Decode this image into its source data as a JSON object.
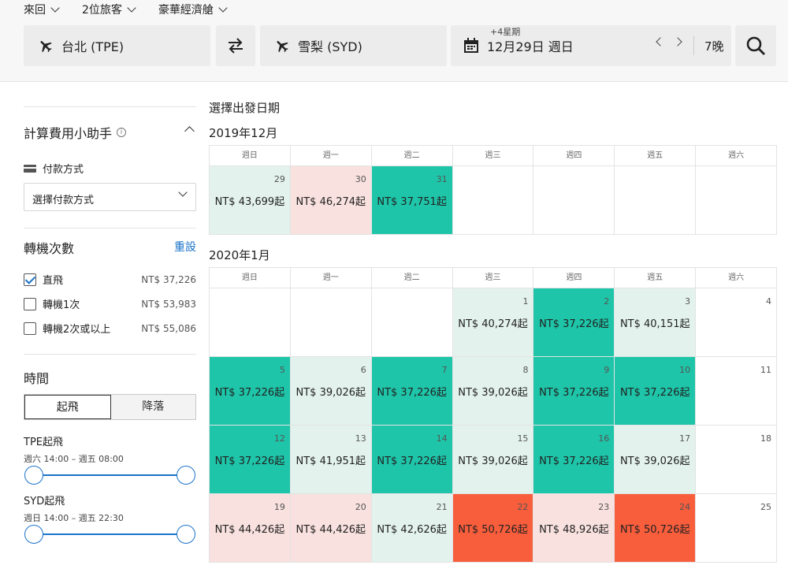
{
  "header": {
    "trip_type": "來回",
    "travelers": "2位旅客",
    "cabin": "豪華經濟艙",
    "from": "台北 (TPE)",
    "to": "雪梨 (SYD)",
    "date_sub": "+4星期",
    "date": "12月29日 週日",
    "nights": "7晚"
  },
  "sidebar": {
    "calc_title": "計算費用小助手",
    "pay_label": "付款方式",
    "pay_select": "選擇付款方式",
    "stops_title": "轉機次數",
    "reset": "重設",
    "stops": [
      {
        "label": "直飛",
        "price": "NT$ 37,226",
        "checked": true
      },
      {
        "label": "轉機1次",
        "price": "NT$ 53,983",
        "checked": false
      },
      {
        "label": "轉機2次或以上",
        "price": "NT$ 55,086",
        "checked": false
      }
    ],
    "time_title": "時間",
    "tab_depart": "起飛",
    "tab_land": "降落",
    "tpe_label": "TPE起飛",
    "tpe_range": "週六 14:00 – 週五 08:00",
    "syd_label": "SYD起飛",
    "syd_range": "週日 14:00 – 週五 22:30"
  },
  "calendar": {
    "heading": "選擇出發日期",
    "weekdays": [
      "週日",
      "週一",
      "週二",
      "週三",
      "週四",
      "週五",
      "週六"
    ],
    "months": [
      {
        "title": "2019年12月",
        "weeks": [
          [
            {
              "day": "29",
              "price": "NT$ 43,699起",
              "tone": "light"
            },
            {
              "day": "30",
              "price": "NT$ 46,274起",
              "tone": "pink"
            },
            {
              "day": "31",
              "price": "NT$ 37,751起",
              "tone": "teal"
            },
            {
              "day": "",
              "price": "",
              "tone": "empty"
            },
            {
              "day": "",
              "price": "",
              "tone": "empty"
            },
            {
              "day": "",
              "price": "",
              "tone": "empty"
            },
            {
              "day": "",
              "price": "",
              "tone": "empty"
            }
          ]
        ]
      },
      {
        "title": "2020年1月",
        "weeks": [
          [
            {
              "day": "",
              "price": "",
              "tone": "empty"
            },
            {
              "day": "",
              "price": "",
              "tone": "empty"
            },
            {
              "day": "",
              "price": "",
              "tone": "empty"
            },
            {
              "day": "1",
              "price": "NT$ 40,274起",
              "tone": "light"
            },
            {
              "day": "2",
              "price": "NT$ 37,226起",
              "tone": "teal"
            },
            {
              "day": "3",
              "price": "NT$ 40,151起",
              "tone": "light"
            },
            {
              "day": "4",
              "price": "",
              "tone": "empty"
            }
          ],
          [
            {
              "day": "5",
              "price": "NT$ 37,226起",
              "tone": "teal"
            },
            {
              "day": "6",
              "price": "NT$ 39,026起",
              "tone": "light"
            },
            {
              "day": "7",
              "price": "NT$ 37,226起",
              "tone": "teal"
            },
            {
              "day": "8",
              "price": "NT$ 39,026起",
              "tone": "light"
            },
            {
              "day": "9",
              "price": "NT$ 37,226起",
              "tone": "teal"
            },
            {
              "day": "10",
              "price": "NT$ 37,226起",
              "tone": "teal"
            },
            {
              "day": "11",
              "price": "",
              "tone": "empty"
            }
          ],
          [
            {
              "day": "12",
              "price": "NT$ 37,226起",
              "tone": "teal"
            },
            {
              "day": "13",
              "price": "NT$ 41,951起",
              "tone": "light"
            },
            {
              "day": "14",
              "price": "NT$ 37,226起",
              "tone": "teal"
            },
            {
              "day": "15",
              "price": "NT$ 39,026起",
              "tone": "light"
            },
            {
              "day": "16",
              "price": "NT$ 37,226起",
              "tone": "teal"
            },
            {
              "day": "17",
              "price": "NT$ 39,026起",
              "tone": "light"
            },
            {
              "day": "18",
              "price": "",
              "tone": "empty"
            }
          ],
          [
            {
              "day": "19",
              "price": "NT$ 44,426起",
              "tone": "pink"
            },
            {
              "day": "20",
              "price": "NT$ 44,426起",
              "tone": "pink"
            },
            {
              "day": "21",
              "price": "NT$ 42,626起",
              "tone": "light"
            },
            {
              "day": "22",
              "price": "NT$ 50,726起",
              "tone": "red"
            },
            {
              "day": "23",
              "price": "NT$ 48,926起",
              "tone": "pink"
            },
            {
              "day": "24",
              "price": "NT$ 50,726起",
              "tone": "red"
            },
            {
              "day": "25",
              "price": "",
              "tone": "empty"
            }
          ]
        ]
      }
    ]
  }
}
